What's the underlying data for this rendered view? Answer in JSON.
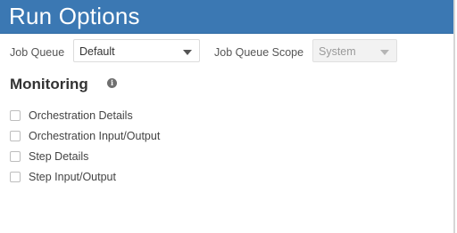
{
  "header": {
    "title": "Run Options"
  },
  "job_queue": {
    "label": "Job Queue",
    "value": "Default"
  },
  "job_queue_scope": {
    "label": "Job Queue Scope",
    "value": "System"
  },
  "monitoring": {
    "heading": "Monitoring",
    "info_glyph": "i",
    "options": [
      {
        "label": "Orchestration Details",
        "checked": false
      },
      {
        "label": "Orchestration Input/Output",
        "checked": false
      },
      {
        "label": "Step Details",
        "checked": false
      },
      {
        "label": "Step Input/Output",
        "checked": false
      }
    ]
  },
  "colors": {
    "header_bg": "#3b78b3",
    "header_text": "#ffffff"
  }
}
